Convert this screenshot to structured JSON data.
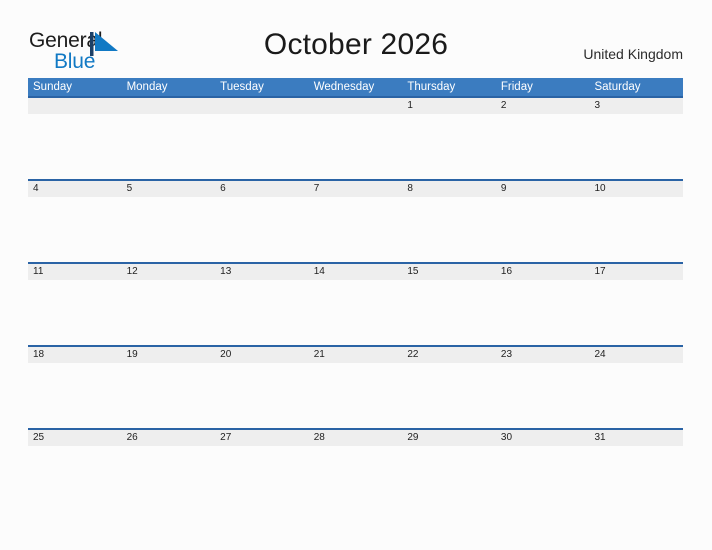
{
  "brand": {
    "name_part1": "General",
    "name_part2": "Blue",
    "flag_icon": "blue-flag-triangle-icon",
    "accent_color": "#1179c4"
  },
  "header": {
    "title": "October 2026",
    "region": "United Kingdom"
  },
  "colors": {
    "header_blue": "#3b7cc0",
    "row_rule_blue": "#2a63a5",
    "date_strip_gray": "#eeeeee",
    "page_background": "#fcfcfc",
    "text_dark": "#1f1f1f"
  },
  "calendar": {
    "month": "October",
    "year": "2026",
    "weekday_headers": [
      "Sunday",
      "Monday",
      "Tuesday",
      "Wednesday",
      "Thursday",
      "Friday",
      "Saturday"
    ],
    "weeks": [
      [
        "",
        "",
        "",
        "",
        "1",
        "2",
        "3"
      ],
      [
        "4",
        "5",
        "6",
        "7",
        "8",
        "9",
        "10"
      ],
      [
        "11",
        "12",
        "13",
        "14",
        "15",
        "16",
        "17"
      ],
      [
        "18",
        "19",
        "20",
        "21",
        "22",
        "23",
        "24"
      ],
      [
        "25",
        "26",
        "27",
        "28",
        "29",
        "30",
        "31"
      ]
    ]
  }
}
